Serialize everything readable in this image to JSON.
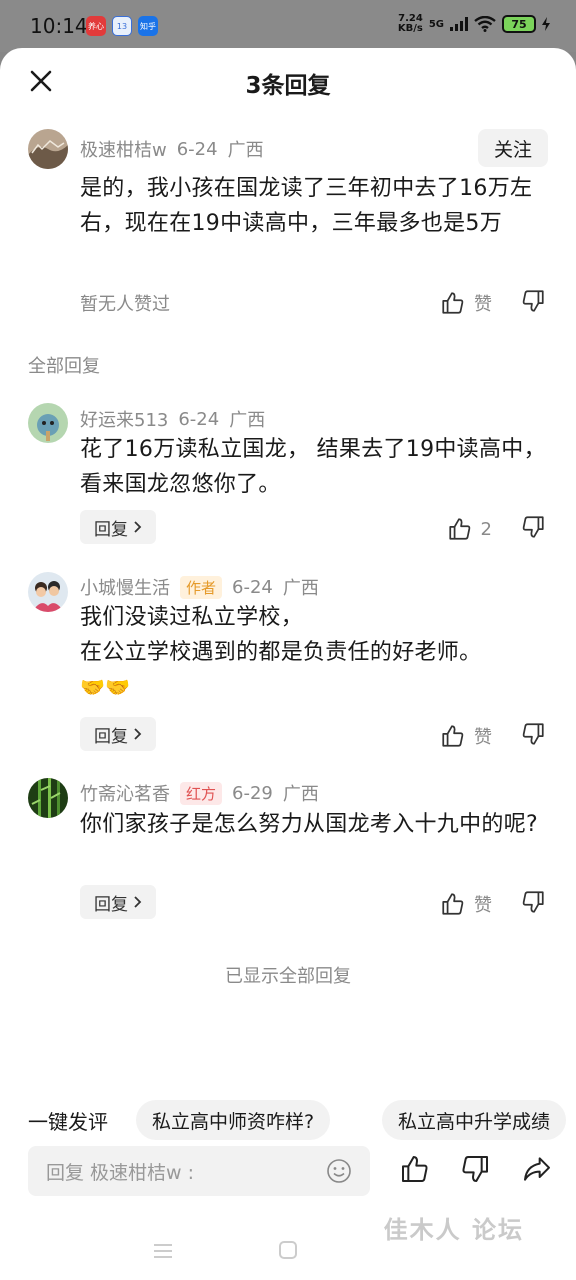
{
  "status_bar": {
    "time": "10:14",
    "apps": [
      "养心",
      "13",
      "知乎"
    ],
    "net_speed_value": "7.24",
    "net_speed_unit": "KB/s",
    "network": "5G",
    "battery": "75"
  },
  "header": {
    "title": "3条回复"
  },
  "main_comment": {
    "author": "极速柑桔w",
    "date": "6-24",
    "location": "广西",
    "follow_label": "关注",
    "text": "是的，我小孩在国龙读了三年初中去了16万左右，现在在19中读高中，三年最多也是5万",
    "no_likes": "暂无人赞过",
    "like_label": "赞"
  },
  "section_label": "全部回复",
  "replies": [
    {
      "author": "好运来513",
      "date": "6-24",
      "location": "广西",
      "tag": "",
      "text": "花了16万读私立国龙， 结果去了19中读高中，看来国龙忽悠你了。",
      "reply_label": "回复",
      "like_text": "2"
    },
    {
      "author": "小城慢生活",
      "date": "6-24",
      "location": "广西",
      "tag": "作者",
      "text_line1": "我们没读过私立学校，",
      "text_line2": "在公立学校遇到的都是负责任的好老师。",
      "emoji": "🤝🤝",
      "reply_label": "回复",
      "like_text": "赞"
    },
    {
      "author": "竹斋沁茗香",
      "date": "6-29",
      "location": "广西",
      "tag": "红方",
      "text": "你们家孩子是怎么努力从国龙考入十九中的呢?",
      "reply_label": "回复",
      "like_text": "赞"
    }
  ],
  "all_shown": "已显示全部回复",
  "quick_comment": {
    "label": "一键发评",
    "chips": [
      "私立高中师资咋样?",
      "私立高中升学成绩"
    ]
  },
  "input": {
    "placeholder": "回复 极速柑桔w :"
  },
  "watermark": "佳木人 论坛"
}
